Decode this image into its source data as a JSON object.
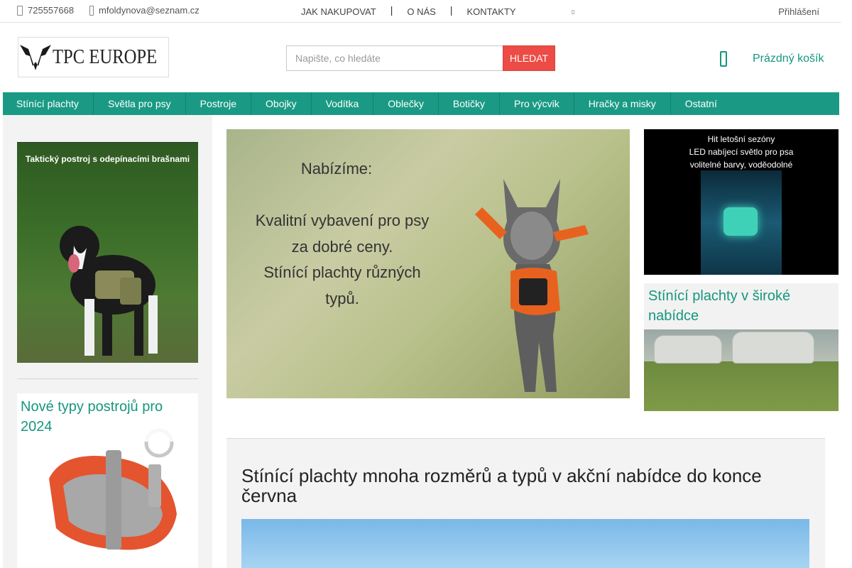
{
  "topbar": {
    "phone": "725557668",
    "email": "mfoldynova@seznam.cz",
    "links": [
      "JAK NAKUPOVAT",
      "O NÁS",
      "KONTAKTY"
    ],
    "login": "Přihlášení"
  },
  "header": {
    "logo_text": "TPC EUROPE",
    "search_placeholder": "Napište, co hledáte",
    "search_button": "HLEDAT",
    "cart_label": "Prázdný košík"
  },
  "nav": {
    "items": [
      "Stínící plachty",
      "Světla pro psy",
      "Postroje",
      "Obojky",
      "Vodítka",
      "Oblečky",
      "Botičky",
      "Pro výcvik",
      "Hračky a misky",
      "Ostatní"
    ]
  },
  "sidebar": {
    "card1_caption": "Taktický postroj s odepínacími brašnami",
    "card2_title": "Nové typy postrojů pro 2024"
  },
  "banner": {
    "line1": "Nabízíme:",
    "line2": "Kvalitní vybavení pro psy",
    "line3": "za dobré ceny.",
    "line4": "Stínící plachty různých",
    "line5": "typů."
  },
  "ads": {
    "ad1_line1": "Hit letošní sezóny",
    "ad1_line2": "LED nabíjecí světlo pro psa",
    "ad1_line3": "volitelné barvy, voděodolné",
    "ad2_title": "Stínící plachty v široké nabídce"
  },
  "article": {
    "title": "Stínící plachty mnoha rozměrů a typů v akční nabídce do konce června"
  },
  "colors": {
    "accent": "#1a9a84",
    "button": "#ec4c45"
  }
}
